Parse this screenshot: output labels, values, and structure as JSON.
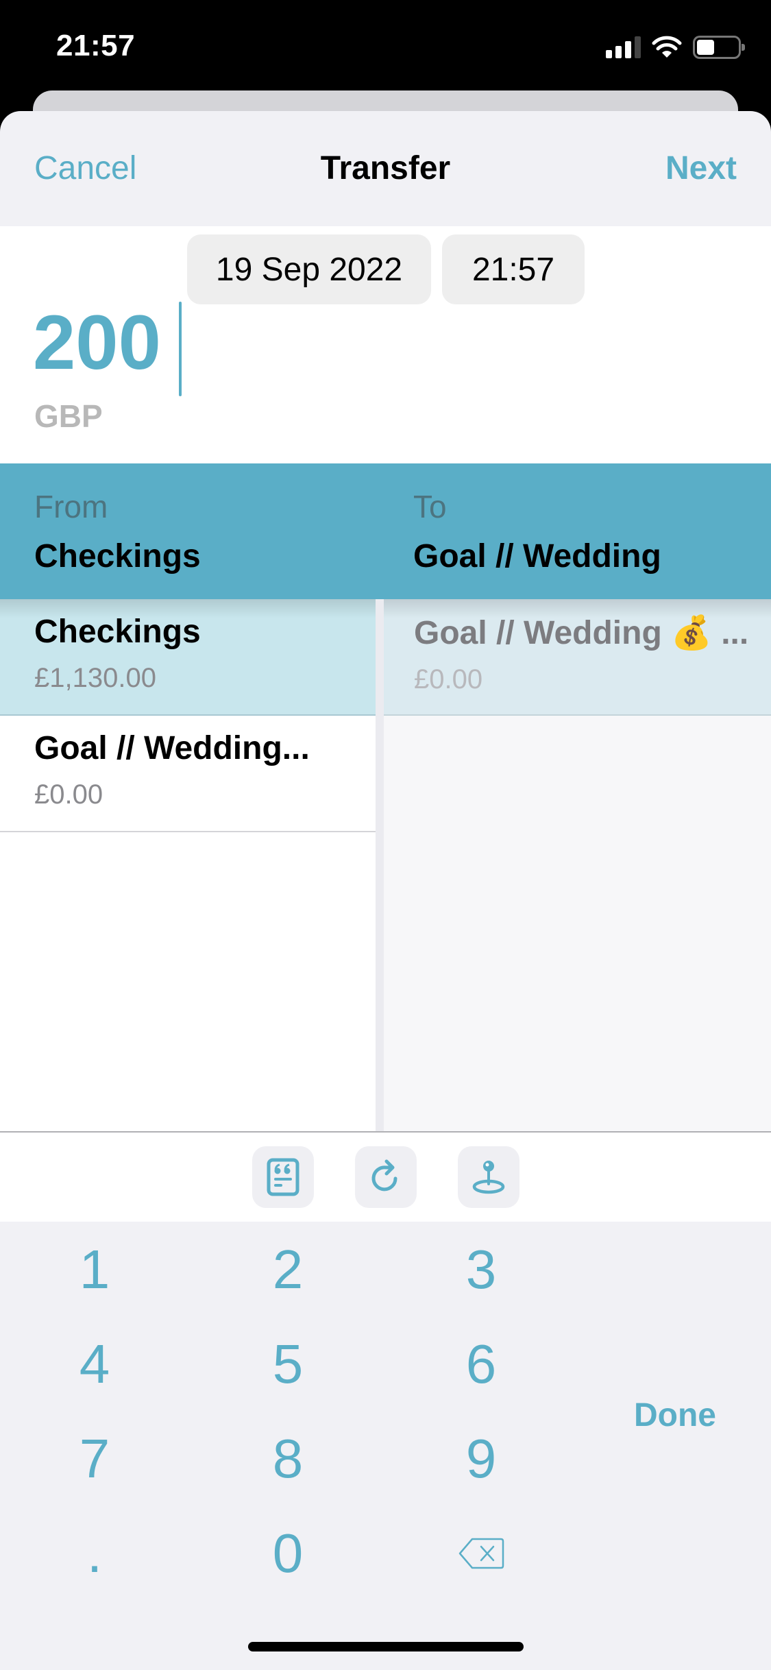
{
  "status_bar": {
    "time": "21:57",
    "icons": [
      "cellular-signal-icon",
      "wifi-icon",
      "battery-icon"
    ],
    "battery_level": 0.35
  },
  "nav": {
    "cancel_label": "Cancel",
    "title": "Transfer",
    "next_label": "Next"
  },
  "entry": {
    "date": "19 Sep 2022",
    "time": "21:57",
    "amount": "200",
    "currency": "GBP"
  },
  "transfer": {
    "from_label": "From",
    "from_value": "Checkings",
    "to_label": "To",
    "to_value": "Goal // Wedding"
  },
  "from_accounts": [
    {
      "name": "Checkings",
      "balance": "£1,130.00",
      "selected": true
    },
    {
      "name": "Goal // Wedding...",
      "balance": "£0.00",
      "selected": false
    }
  ],
  "to_accounts": [
    {
      "name": "Goal // Wedding 💰 ...",
      "balance": "£0.00",
      "selected": true
    }
  ],
  "toolbar": {
    "buttons": [
      {
        "name": "note-icon"
      },
      {
        "name": "repeat-icon"
      },
      {
        "name": "location-pin-icon"
      }
    ]
  },
  "keypad": {
    "keys": [
      "1",
      "2",
      "3",
      "4",
      "5",
      "6",
      "7",
      "8",
      "9",
      ".",
      "0"
    ],
    "backspace_icon": "backspace-icon",
    "done_label": "Done"
  },
  "colors": {
    "accent": "#5aaec7",
    "selected_row": "#c8e6ed",
    "background": "#f1f1f5"
  }
}
